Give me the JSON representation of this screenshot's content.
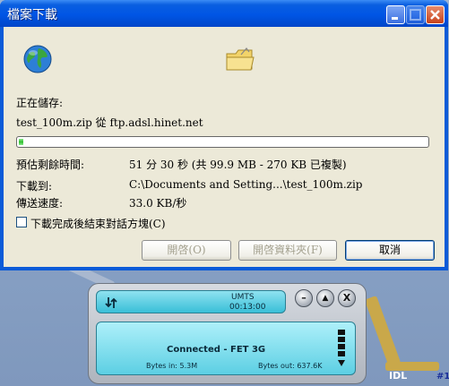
{
  "dialog": {
    "title": "檔案下載",
    "saving_label": "正在儲存:",
    "source_line": "test_100m.zip 從 ftp.adsl.hinet.net",
    "progress_fraction": 0.012,
    "remaining_label": "預估剩餘時間:",
    "remaining_value": "51 分 30 秒 (共 99.9 MB - 270 KB 已複製)",
    "download_to_label": "下載到:",
    "download_to_value": "C:\\Documents and Setting...\\test_100m.zip",
    "speed_label": "傳送速度:",
    "speed_value": "33.0 KB/秒",
    "close_when_done_label": "下載完成後結束對話方塊(C)",
    "close_when_done_checked": false,
    "buttons": {
      "open": "開啓(O)",
      "open_folder": "開啓資料夾(F)",
      "cancel": "取消"
    },
    "icons": {
      "globe": "globe-icon",
      "folder": "folder-icon",
      "minimize": "minimize-icon",
      "maximize": "maximize-icon",
      "close": "close-icon"
    }
  },
  "dialer": {
    "network_type": "UMTS",
    "elapsed": "00:13:00",
    "status": "Connected - FET 3G",
    "bytes_in": "Bytes in: 5.3M",
    "bytes_out": "Bytes out: 637.6K",
    "buttons": {
      "minimize": "–",
      "eject": "▲",
      "close": "X"
    }
  },
  "desktop": {
    "map_label_idl": "IDL",
    "map_label_right": "#1"
  }
}
